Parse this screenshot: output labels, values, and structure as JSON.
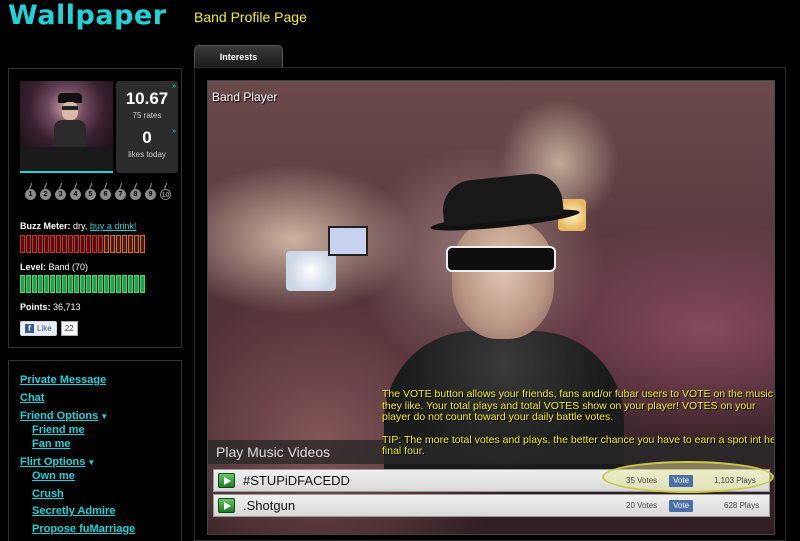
{
  "header": {
    "site_title": "Wallpaper",
    "page_label": "Band Profile Page",
    "tab_label": "Interests"
  },
  "profile": {
    "rating": "10.67",
    "rates": "75 rates",
    "likes": "0",
    "likes_label": "likes today",
    "level_dots": [
      "1",
      "2",
      "3",
      "4",
      "5",
      "6",
      "7",
      "8",
      "9",
      "10"
    ],
    "buzz_meter_label": "Buzz Meter:",
    "buzz_meter_value": "dry,",
    "buzz_meter_link": "buy a drink!",
    "level_label": "Level:",
    "level_value": "Band (70)",
    "points_label": "Points:",
    "points_value": "36,713",
    "fb_like_label": "Like",
    "fb_like_count": "22"
  },
  "menu": {
    "private_message": "Private Message",
    "chat": "Chat",
    "friend_options": "Friend Options",
    "friend_me": "Friend me",
    "fan_me": "Fan me",
    "flirt_options": "Flirt Options",
    "own_me": "Own me",
    "crush": "Crush",
    "secretly_admire": "Secretly Admire",
    "propose": "Propose fuMarriage"
  },
  "player": {
    "title": "Band Player",
    "tip_1": "The VOTE button allows your friends, fans and/or fubar users to VOTE on the music they  like. Your total plays and total VOTES show on your player! VOTES on your player do not count toward your daily battle votes.",
    "tip_2": "TIP: The more total votes and plays, the better chance you have to earn a spot int he final four.",
    "videos_label": "Play Music Videos",
    "tracks": [
      {
        "name": "#STUPiDFACEDD",
        "votes": "35 Votes",
        "vote_btn": "Vote",
        "plays": "1,103 Plays"
      },
      {
        "name": ".Shotgun",
        "votes": "20 Votes",
        "vote_btn": "Vote",
        "plays": "628 Plays"
      }
    ]
  },
  "colors": {
    "accent": "#1fd3d8",
    "tip_yellow": "#f3f02a",
    "buzz_red": "#c8322a",
    "level_green": "#1fa24b"
  }
}
